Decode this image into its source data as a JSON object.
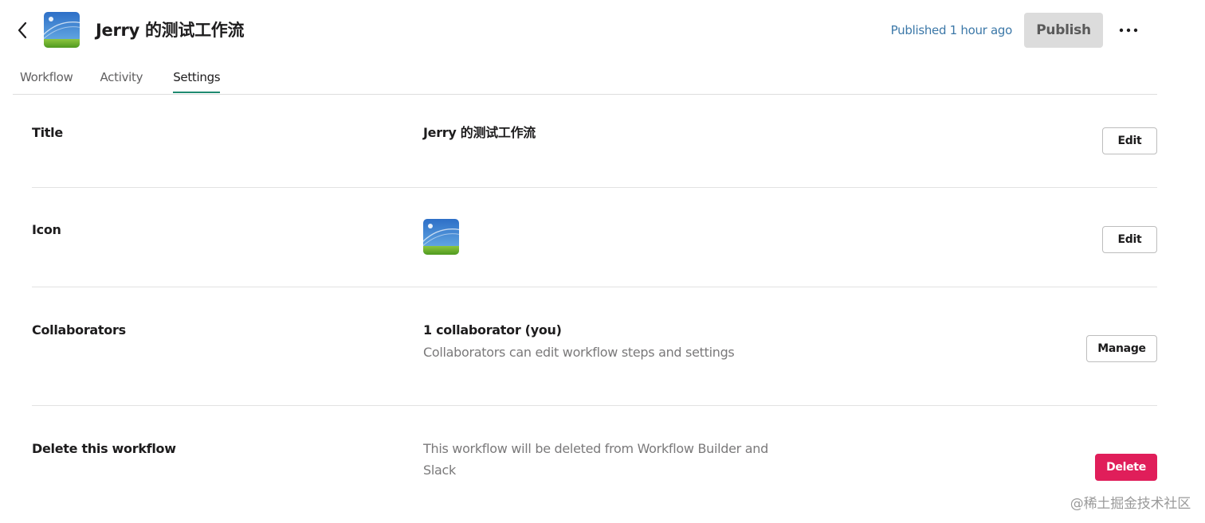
{
  "header": {
    "back_icon": "chevron-left-icon",
    "workflow_title": "Jerry 的测试工作流",
    "published_status": "Published 1 hour ago",
    "publish_label": "Publish",
    "more_icon": "more-horizontal-icon"
  },
  "tabs": [
    {
      "label": "Workflow",
      "active": false
    },
    {
      "label": "Activity",
      "active": false
    },
    {
      "label": "Settings",
      "active": true
    }
  ],
  "settings": {
    "title": {
      "label": "Title",
      "value": "Jerry 的测试工作流",
      "button": "Edit"
    },
    "icon": {
      "label": "Icon",
      "button": "Edit"
    },
    "collaborators": {
      "label": "Collaborators",
      "value": "1 collaborator (you)",
      "description": "Collaborators can edit workflow steps and settings",
      "button": "Manage"
    },
    "delete": {
      "label": "Delete this workflow",
      "description_line1": "This workflow will be deleted from Workflow Builder and",
      "description_line2": "Slack",
      "button": "Delete"
    }
  },
  "watermark": "@稀土掘金技术社区",
  "colors": {
    "accent_tab": "#1f8a70",
    "published_text": "#3c78a8",
    "delete_button": "#e01e5a",
    "publish_button_bg": "#dcdcdc"
  }
}
